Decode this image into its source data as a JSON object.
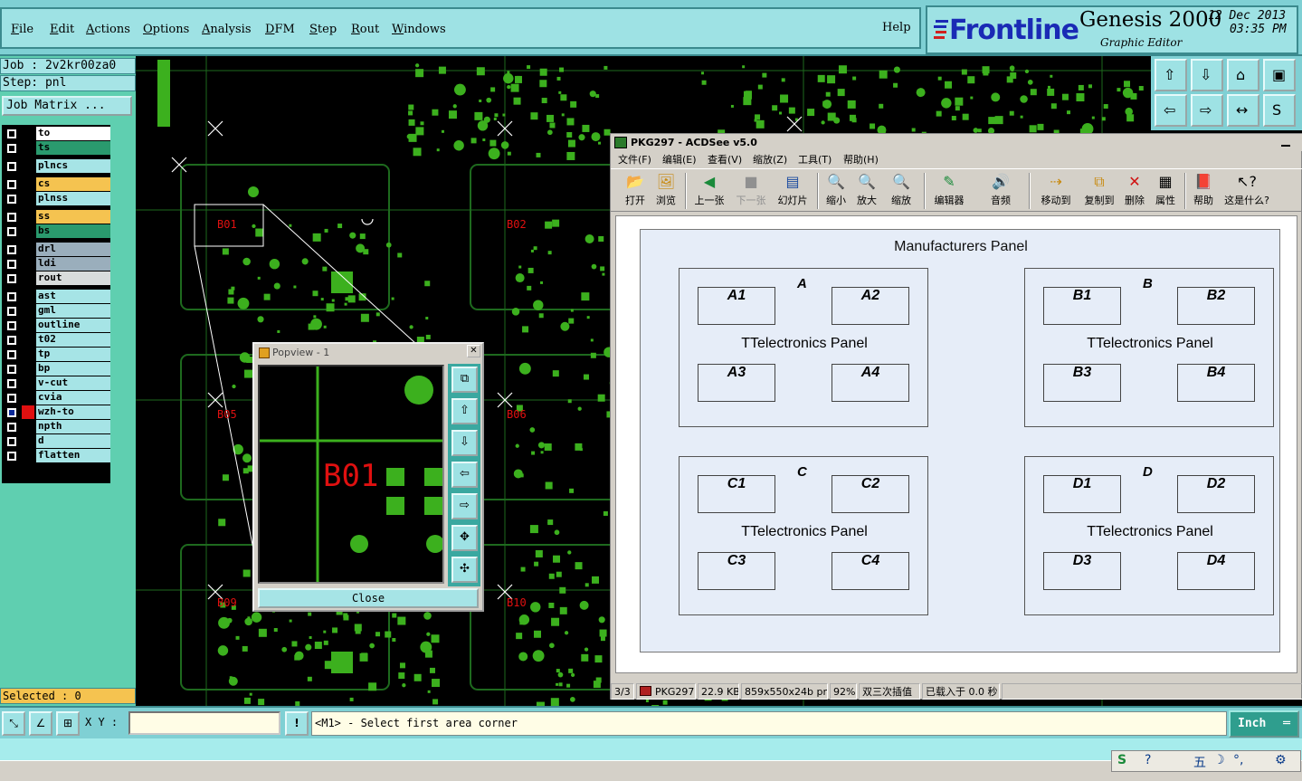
{
  "menubar": {
    "items": [
      "File",
      "Edit",
      "Actions",
      "Options",
      "Analysis",
      "DFM",
      "Step",
      "Rout",
      "Windows"
    ],
    "help": "Help"
  },
  "brand": {
    "logo": "Frontline",
    "product": "Genesis 2000",
    "subtitle": "Graphic Editor",
    "date": "12 Dec 2013",
    "time": "03:35 PM"
  },
  "job": {
    "job": "Job : 2v2kr00za0",
    "step": "Step: pnl",
    "matrix_button": "Job Matrix ..."
  },
  "layers": [
    {
      "name": "to",
      "color": "#ffffff",
      "swatch": "#000000",
      "checked": false
    },
    {
      "name": "ts",
      "color": "#2a9a6e",
      "swatch": "#000000",
      "checked": false
    },
    {
      "name": "plncs",
      "color": "#a6e4e6",
      "swatch": "#000000",
      "checked": false
    },
    {
      "name": "cs",
      "color": "#f5c350",
      "swatch": "#000000",
      "checked": false
    },
    {
      "name": "plnss",
      "color": "#a6e4e6",
      "swatch": "#000000",
      "checked": false
    },
    {
      "name": "ss",
      "color": "#f5c350",
      "swatch": "#000000",
      "checked": false
    },
    {
      "name": "bs",
      "color": "#2a9a6e",
      "swatch": "#000000",
      "checked": false
    },
    {
      "name": "drl",
      "color": "#9aaebc",
      "swatch": "#000000",
      "checked": false
    },
    {
      "name": "ldi",
      "color": "#9aaebc",
      "swatch": "#000000",
      "checked": false
    },
    {
      "name": "rout",
      "color": "#d8dcdc",
      "swatch": "#000000",
      "checked": false
    },
    {
      "name": "ast",
      "color": "#a6e4e6",
      "swatch": "#000000",
      "checked": false
    },
    {
      "name": "gml",
      "color": "#a6e4e6",
      "swatch": "#000000",
      "checked": false
    },
    {
      "name": "outline",
      "color": "#a6e4e6",
      "swatch": "#000000",
      "checked": false
    },
    {
      "name": "t02",
      "color": "#a6e4e6",
      "swatch": "#000000",
      "checked": false
    },
    {
      "name": "tp",
      "color": "#a6e4e6",
      "swatch": "#000000",
      "checked": false
    },
    {
      "name": "bp",
      "color": "#a6e4e6",
      "swatch": "#000000",
      "checked": false
    },
    {
      "name": "v-cut",
      "color": "#a6e4e6",
      "swatch": "#000000",
      "checked": false
    },
    {
      "name": "cvia",
      "color": "#a6e4e6",
      "swatch": "#000000",
      "checked": false
    },
    {
      "name": "wzh-to",
      "color": "#a6e4e6",
      "swatch": "#e01010",
      "checked": true
    },
    {
      "name": "npth",
      "color": "#a6e4e6",
      "swatch": "#000000",
      "checked": false
    },
    {
      "name": "d",
      "color": "#a6e4e6",
      "swatch": "#000000",
      "checked": false
    },
    {
      "name": "flatten",
      "color": "#a6e4e6",
      "swatch": "#000000",
      "checked": false
    }
  ],
  "selected": "Selected : 0",
  "canvas_labels": [
    "B01",
    "B02",
    "B05",
    "B06",
    "B09",
    "B10"
  ],
  "popview": {
    "title": "Popview - 1",
    "label": "B01",
    "close": "Close"
  },
  "bottom": {
    "xy_label": "X Y :",
    "xy_value": "",
    "message": "<M1> - Select first area corner",
    "unit": "Inch"
  },
  "acdsee": {
    "title": "PKG297 - ACDSee v5.0",
    "menu": [
      "文件(F)",
      "编辑(E)",
      "查看(V)",
      "缩放(Z)",
      "工具(T)",
      "帮助(H)"
    ],
    "toolbar": [
      "打开",
      "浏览",
      "上一张",
      "下一张",
      "幻灯片",
      "缩小",
      "放大",
      "缩放",
      "编辑器",
      "音频",
      "移动到",
      "复制到",
      "删除",
      "属性",
      "帮助",
      "这是什么?"
    ],
    "status": [
      "3/3",
      "PKG297",
      "22.9 KB",
      "859x550x24b png",
      "92%",
      "双三次插值",
      "已载入于 0.0 秒"
    ]
  },
  "panel": {
    "title": "Manufacturers Panel",
    "quads": [
      {
        "letter": "A",
        "name": "TTelectronics Panel",
        "cells": [
          "A1",
          "A2",
          "A3",
          "A4"
        ]
      },
      {
        "letter": "B",
        "name": "TTelectronics Panel",
        "cells": [
          "B1",
          "B2",
          "B3",
          "B4"
        ]
      },
      {
        "letter": "C",
        "name": "TTelectronics Panel",
        "cells": [
          "C1",
          "C2",
          "C3",
          "C4"
        ]
      },
      {
        "letter": "D",
        "name": "TTelectronics Panel",
        "cells": [
          "D1",
          "D2",
          "D3",
          "D4"
        ]
      }
    ]
  },
  "ime": [
    "五",
    "☽",
    "°,",
    "⚙"
  ],
  "colors": {
    "pcb_green": "#3cb01e",
    "grid_green": "#1e6a1e",
    "pad_label_red": "#e01010",
    "logo_blue": "#1a2ab5"
  }
}
